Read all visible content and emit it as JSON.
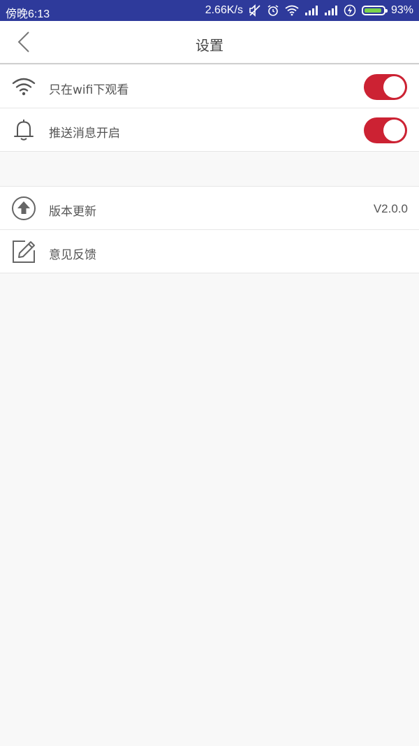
{
  "status_bar": {
    "time": "傍晚6:13",
    "network_speed": "2.66K/s",
    "battery_percent": "93%",
    "battery_level": 0.93,
    "icons": [
      "mute-icon",
      "alarm-icon",
      "wifi-icon",
      "signal-icon",
      "signal-icon",
      "charging-icon",
      "battery-icon"
    ]
  },
  "header": {
    "title": "设置",
    "back_icon": "chevron-left-icon"
  },
  "settings": {
    "toggles": [
      {
        "label": "只在wifi下观看",
        "icon": "wifi-icon",
        "enabled": true
      },
      {
        "label": "推送消息开启",
        "icon": "bell-icon",
        "enabled": true
      }
    ],
    "items": [
      {
        "label": "版本更新",
        "icon": "upload-arrow-icon",
        "value": "V2.0.0"
      },
      {
        "label": "意见反馈",
        "icon": "edit-icon",
        "value": ""
      }
    ]
  },
  "colors": {
    "status_bar_bg": "#2e3a9b",
    "toggle_on": "#cc2233",
    "page_bg": "#f8f8f8",
    "battery_fill": "#7bd44a"
  }
}
